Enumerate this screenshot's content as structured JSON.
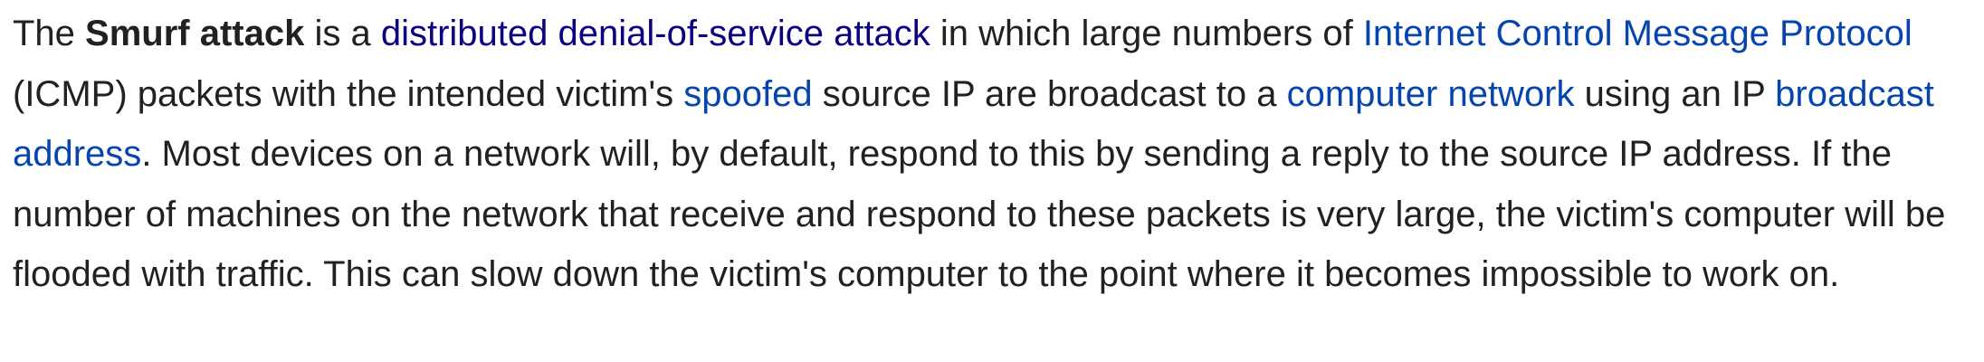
{
  "article": {
    "segments": [
      {
        "type": "text",
        "text": "The "
      },
      {
        "type": "bold",
        "text": "Smurf attack"
      },
      {
        "type": "text",
        "text": " is a "
      },
      {
        "type": "link",
        "text": "distributed denial-of-service attack",
        "name": "link-distributed-denial-of-service-attack",
        "visited": true
      },
      {
        "type": "text",
        "text": " in which large numbers of "
      },
      {
        "type": "link",
        "text": "Internet Control Message Protocol",
        "name": "link-internet-control-message-protocol",
        "visited": false
      },
      {
        "type": "text",
        "text": " (ICMP) packets with the intended victim's "
      },
      {
        "type": "link",
        "text": "spoofed",
        "name": "link-spoofed",
        "visited": false
      },
      {
        "type": "text",
        "text": " source IP are broadcast to a "
      },
      {
        "type": "link",
        "text": "computer network",
        "name": "link-computer-network",
        "visited": false
      },
      {
        "type": "text",
        "text": " using an IP "
      },
      {
        "type": "link",
        "text": "broadcast address",
        "name": "link-broadcast-address",
        "visited": false
      },
      {
        "type": "text",
        "text": ". Most devices on a network will, by default, respond to this by sending a reply to the source IP address. If the number of machines on the network that receive and respond to these packets is very large, the victim's computer will be flooded with traffic. This can slow down the victim's computer to the point where it becomes impossible to work on."
      }
    ]
  },
  "colors": {
    "text": "#202122",
    "link": "#0645ad",
    "link_visited": "#0b0080",
    "background": "#ffffff"
  }
}
